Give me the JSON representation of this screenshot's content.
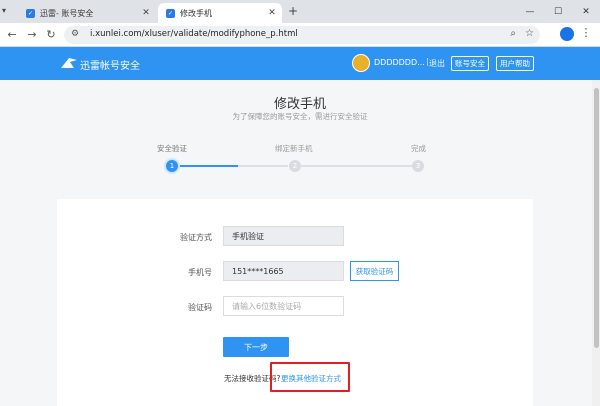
{
  "browser": {
    "tabs": [
      {
        "title": "迅雷- 账号安全",
        "favicon": "xunlei-icon",
        "active": false
      },
      {
        "title": "修改手机",
        "favicon": "xunlei-icon",
        "active": true
      }
    ],
    "new_tab": "+",
    "address": "i.xunlei.com/xluser/validate/modifyphone_p.html",
    "controls": {
      "minimize": "—",
      "maximize": "☐",
      "close": "✕"
    }
  },
  "site_header": {
    "logo_text": "迅雷帐号安全",
    "username": "DDDDDDD...",
    "separator": "|",
    "logout": "退出",
    "security_button": "账号安全",
    "help_button": "用户帮助",
    "colors": {
      "brand": "#2f94f1"
    }
  },
  "page": {
    "title": "修改手机",
    "subtitle": "为了保障您的账号安全，需进行安全验证"
  },
  "steps": [
    {
      "label": "安全验证",
      "number": "1",
      "active": true
    },
    {
      "label": "绑定新手机",
      "number": "2",
      "active": false
    },
    {
      "label": "完成",
      "number": "3",
      "active": false
    }
  ],
  "form": {
    "method_label": "验证方式",
    "method_value": "手机验证",
    "phone_label": "手机号",
    "phone_value": "151****1665",
    "get_code_button": "获取验证码",
    "code_label": "验证码",
    "code_placeholder": "请输入6位数验证码",
    "next_button": "下一步",
    "cant_receive": "无法接收验证码?",
    "other_method_link": "更换其他验证方式"
  }
}
